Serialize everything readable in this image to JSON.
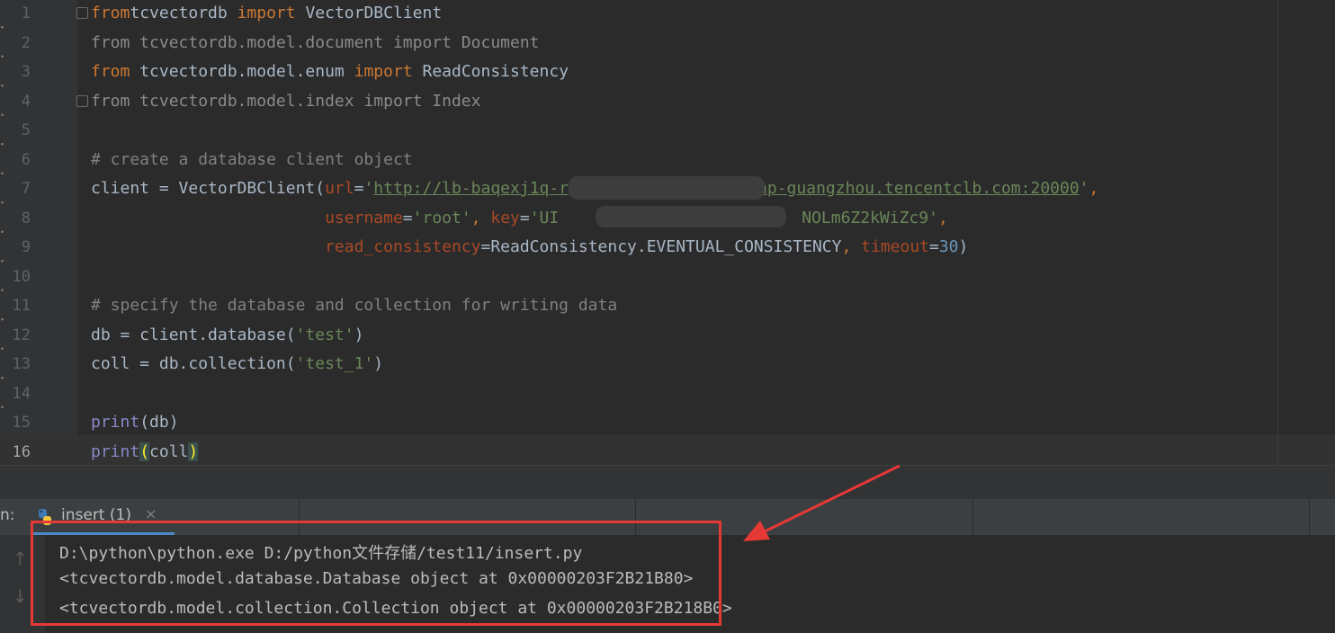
{
  "editor": {
    "lines": [
      {
        "n": "1",
        "tokens": [
          [
            "kw",
            "from"
          ],
          [
            "",
            "tcvectordb "
          ],
          [
            "kw",
            "import"
          ],
          [
            "",
            " VectorDBClient"
          ]
        ]
      },
      {
        "n": "2",
        "tokens": [
          [
            "dim",
            "from tcvectordb.model.document import Document"
          ]
        ]
      },
      {
        "n": "3",
        "tokens": [
          [
            "kw",
            "from"
          ],
          [
            "",
            " tcvectordb.model.enum "
          ],
          [
            "kw",
            "import"
          ],
          [
            "",
            " ReadConsistency"
          ]
        ]
      },
      {
        "n": "4",
        "tokens": [
          [
            "dim",
            "from tcvectordb.model.index import Index"
          ]
        ]
      },
      {
        "n": "5",
        "tokens": []
      },
      {
        "n": "6",
        "tokens": [
          [
            "comment",
            "# create a database client object"
          ]
        ]
      },
      {
        "n": "7",
        "tokens": [
          [
            "",
            "client = VectorDBClient("
          ],
          [
            "param",
            "url"
          ],
          [
            "",
            "="
          ],
          [
            "str",
            "'"
          ],
          [
            "url",
            "http://lb-baqexj1q-r"
          ],
          [
            "blur",
            ""
          ],
          [
            "url",
            "ap-guangzhou.tencentclb.com:20000"
          ],
          [
            "str",
            "'"
          ],
          [
            "kw",
            ","
          ]
        ]
      },
      {
        "n": "8",
        "tokens": [
          [
            "",
            "                        "
          ],
          [
            "param",
            "username"
          ],
          [
            "",
            "="
          ],
          [
            "str",
            "'root'"
          ],
          [
            "kw",
            ", "
          ],
          [
            "param",
            "key"
          ],
          [
            "",
            "="
          ],
          [
            "str",
            "'UI"
          ],
          [
            "blur",
            ""
          ],
          [
            "str",
            "NOLm6Z2kWiZc9'"
          ],
          [
            "kw",
            ","
          ]
        ]
      },
      {
        "n": "9",
        "tokens": [
          [
            "",
            "                        "
          ],
          [
            "param",
            "read_consistency"
          ],
          [
            "",
            "=ReadConsistency.EVENTUAL_CONSISTENCY"
          ],
          [
            "kw",
            ", "
          ],
          [
            "param",
            "timeout"
          ],
          [
            "",
            "="
          ],
          [
            "num",
            "30"
          ],
          [
            "",
            ")"
          ]
        ]
      },
      {
        "n": "10",
        "tokens": []
      },
      {
        "n": "11",
        "tokens": [
          [
            "comment",
            "# specify the database and collection for writing data"
          ]
        ]
      },
      {
        "n": "12",
        "tokens": [
          [
            "",
            "db = client.database("
          ],
          [
            "str",
            "'test'"
          ],
          [
            "",
            ")"
          ]
        ]
      },
      {
        "n": "13",
        "tokens": [
          [
            "",
            "coll = db.collection("
          ],
          [
            "str",
            "'test_1'"
          ],
          [
            "",
            ")"
          ]
        ]
      },
      {
        "n": "14",
        "tokens": []
      },
      {
        "n": "15",
        "tokens": [
          [
            "builtin",
            "print"
          ],
          [
            "",
            "(db)"
          ]
        ]
      },
      {
        "n": "16",
        "tokens": [
          [
            "builtin",
            "print"
          ],
          [
            "paren",
            "("
          ],
          [
            "",
            "coll"
          ],
          [
            "paren",
            ")"
          ]
        ]
      }
    ]
  },
  "run_panel": {
    "label": "n:",
    "tab_label": "insert (1)",
    "close_glyph": "×",
    "up_icon": "↑",
    "down_icon": "↓"
  },
  "console": {
    "lines": [
      "D:\\python\\python.exe D:/python文件存储/test11/insert.py",
      "<tcvectordb.model.database.Database object at 0x00000203F2B21B80>",
      "<tcvectordb.model.collection.Collection object at 0x00000203F2B218B0>"
    ]
  },
  "colors": {
    "editor_bg": "#2b2b2b",
    "keyword": "#cc7832",
    "string": "#6a8759",
    "annotation_red": "#e53935"
  }
}
